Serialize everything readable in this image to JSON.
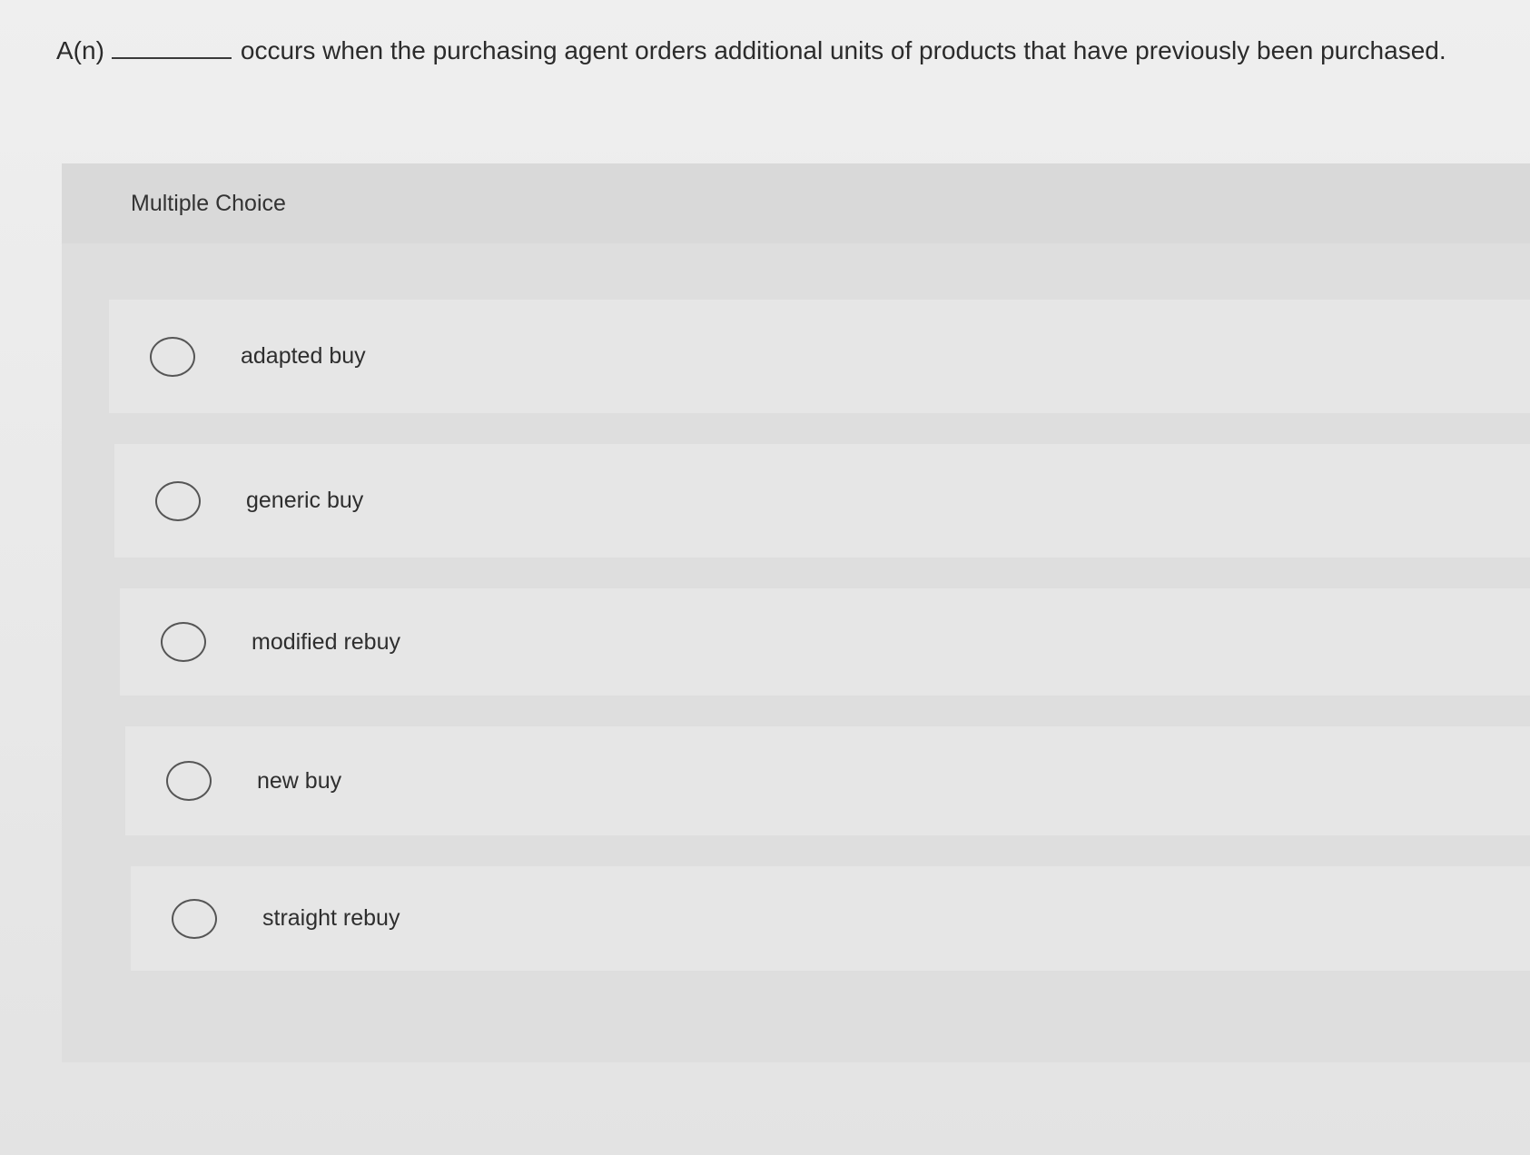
{
  "question": {
    "prefix": "A(n)",
    "text": "occurs when the purchasing agent orders additional units of products that have previously been purchased."
  },
  "panel": {
    "title": "Multiple Choice"
  },
  "options": [
    {
      "label": "adapted buy"
    },
    {
      "label": "generic buy"
    },
    {
      "label": "modified rebuy"
    },
    {
      "label": "new buy"
    },
    {
      "label": "straight rebuy"
    }
  ]
}
